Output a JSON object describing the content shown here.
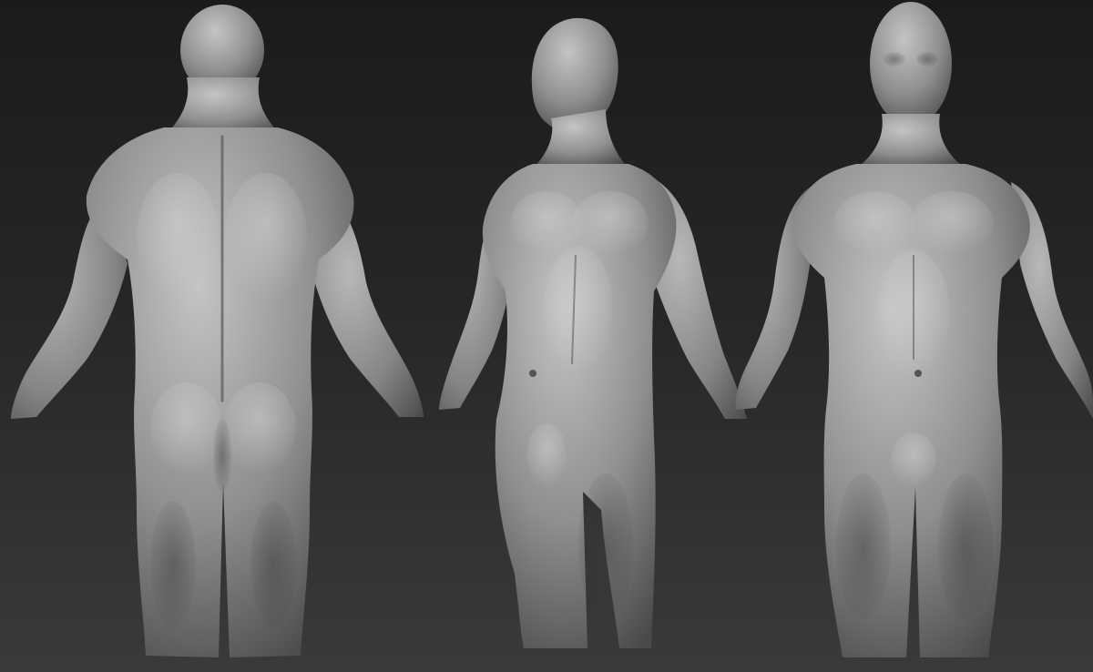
{
  "viewport": {
    "background_top": "#1b1b1b",
    "background_bottom": "#3a3a3a",
    "surface_color": "#8f8f8f",
    "surface_highlight": "#c4c4c4",
    "surface_shadow": "#4a4a4a"
  },
  "models": [
    {
      "id": "back-view",
      "view": "back"
    },
    {
      "id": "three-quarter-view",
      "view": "three-quarter"
    },
    {
      "id": "front-view",
      "view": "front"
    }
  ]
}
